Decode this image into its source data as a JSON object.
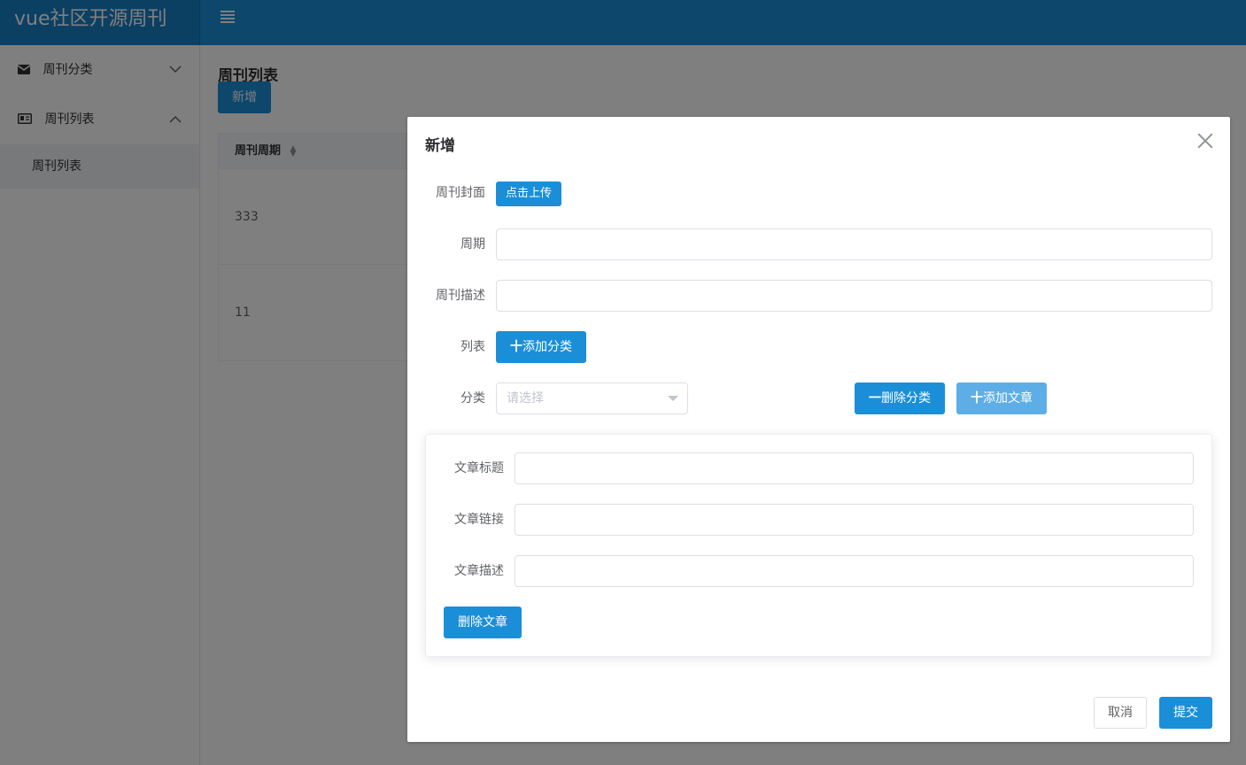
{
  "app": {
    "title": "vue社区开源周刊"
  },
  "sidebar": {
    "items": [
      {
        "label": "周刊分类",
        "icon": "envelope-icon",
        "expanded": false
      },
      {
        "label": "周刊列表",
        "icon": "id-card-icon",
        "expanded": true,
        "children": [
          {
            "label": "周刊列表"
          }
        ]
      }
    ]
  },
  "main": {
    "title": "周刊列表",
    "add_button": "新增",
    "table": {
      "columns": [
        "周刊周期"
      ],
      "rows": [
        [
          "333"
        ],
        [
          "11"
        ]
      ]
    }
  },
  "dialog": {
    "title": "新增",
    "cover_label": "周刊封面",
    "upload_button": "点击上传",
    "period_label": "周期",
    "period_value": "",
    "desc_label": "周刊描述",
    "desc_value": "",
    "list_label": "列表",
    "add_category_button": "添加分类",
    "category_label": "分类",
    "category_placeholder": "请选择",
    "delete_category_button": "删除分类",
    "add_article_button": "添加文章",
    "article": {
      "title_label": "文章标题",
      "title_value": "",
      "link_label": "文章链接",
      "link_value": "",
      "desc_label": "文章描述",
      "desc_value": "",
      "delete_button": "删除文章"
    },
    "cancel_button": "取消",
    "submit_button": "提交"
  },
  "colors": {
    "primary": "#1a8fd8",
    "primary_light": "#5daee6"
  }
}
